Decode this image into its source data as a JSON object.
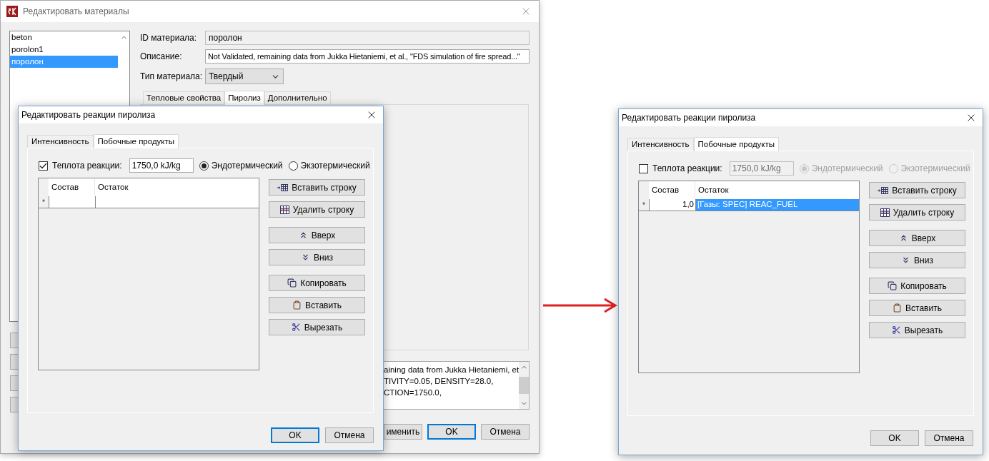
{
  "main_window": {
    "title": "Редактировать материалы",
    "materials": [
      {
        "label": "beton",
        "selected": false
      },
      {
        "label": "porolon1",
        "selected": false
      },
      {
        "label": "поролон",
        "selected": true
      }
    ],
    "id_field": {
      "label": "ID материала:",
      "value": "поролон"
    },
    "description_field": {
      "label": "Описание:",
      "value": "Not Validated, remaining data from Jukka Hietaniemi, et al., \"FDS simulation of fire spread...\""
    },
    "type_field": {
      "label": "Тип материала:",
      "value": "Твердый"
    },
    "tabs": [
      {
        "label": "Тепловые свойства",
        "selected": false
      },
      {
        "label": "Пиролиз",
        "selected": true
      },
      {
        "label": "Дополнительно",
        "selected": false
      }
    ],
    "notes_lines": [
      "aining data from Jukka Hietaniemi, et",
      "TIVITY=0.05, DENSITY=28.0,",
      "CTION=1750.0,"
    ],
    "buttons": [
      {
        "label": "именить",
        "default": false
      },
      {
        "label": "OK",
        "default": true
      },
      {
        "label": "Отмена",
        "default": false
      }
    ]
  },
  "dialogs": [
    {
      "title": "Редактировать реакции пиролиза",
      "tabs": [
        {
          "label": "Интенсивность",
          "selected": false
        },
        {
          "label": "Побочные продукты",
          "selected": true
        }
      ],
      "heat": {
        "checked": true,
        "label": "Теплота реакции:",
        "value": "1750,0 kJ/kg"
      },
      "radios": [
        {
          "label": "Эндотермический",
          "selected": true
        },
        {
          "label": "Экзотермический",
          "selected": false
        }
      ],
      "columns": [
        "Состав",
        "Остаток"
      ],
      "rows": [
        {
          "marker": "*",
          "selected": false
        }
      ],
      "action_groups": [
        [
          {
            "kind": "insert",
            "label": "Вставить строку"
          },
          {
            "kind": "delete",
            "label": "Удалить строку"
          }
        ],
        [
          {
            "kind": "up",
            "label": "Вверх"
          },
          {
            "kind": "down",
            "label": "Вниз"
          }
        ],
        [
          {
            "kind": "copy",
            "label": "Копировать"
          },
          {
            "kind": "paste",
            "label": "Вставить"
          },
          {
            "kind": "cut",
            "label": "Вырезать"
          }
        ]
      ],
      "footer": [
        {
          "label": "OK",
          "default": true
        },
        {
          "label": "Отмена",
          "default": false
        }
      ]
    },
    {
      "title": "Редактировать реакции пиролиза",
      "tabs": [
        {
          "label": "Интенсивность",
          "selected": false
        },
        {
          "label": "Побочные продукты",
          "selected": true
        }
      ],
      "heat": {
        "checked": false,
        "label": "Теплота реакции:",
        "value": "1750,0 kJ/kg"
      },
      "radios": [
        {
          "label": "Эндотермический",
          "selected": true
        },
        {
          "label": "Экзотермический",
          "selected": false
        }
      ],
      "columns": [
        "Состав",
        "Остаток"
      ],
      "rows": [
        {
          "marker": "*",
          "cells": [
            "1,0",
            "[Газы: SPEC] REAC_FUEL"
          ],
          "selected": true
        }
      ],
      "action_groups": [
        [
          {
            "kind": "insert",
            "label": "Вставить строку"
          },
          {
            "kind": "delete",
            "label": "Удалить строку"
          }
        ],
        [
          {
            "kind": "up",
            "label": "Вверх"
          },
          {
            "kind": "down",
            "label": "Вниз"
          }
        ],
        [
          {
            "kind": "copy",
            "label": "Копировать"
          },
          {
            "kind": "paste",
            "label": "Вставить"
          },
          {
            "kind": "cut",
            "label": "Вырезать"
          }
        ]
      ],
      "footer": [
        {
          "label": "OK",
          "default": false
        },
        {
          "label": "Отмена",
          "default": false
        }
      ]
    }
  ]
}
